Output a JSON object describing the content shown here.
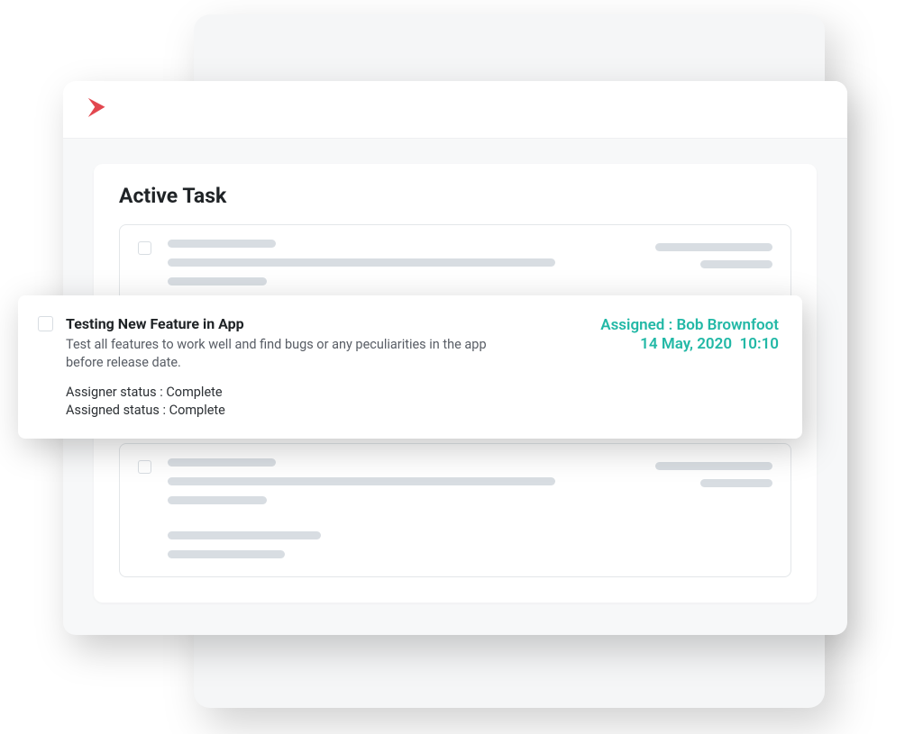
{
  "panel": {
    "title": "Active Task"
  },
  "highlighted_task": {
    "title": "Testing New Feature in App",
    "description": "Test all features to work well and find bugs or any peculiarities in the app before release date.",
    "assigner_status_label": "Assigner status :",
    "assigner_status_value": "Complete",
    "assigned_status_label": "Assigned status :",
    "assigned_status_value": "Complete",
    "assigned_label": "Assigned :",
    "assigned_to": "Bob Brownfoot",
    "date": "14 May, 2020",
    "time": "10:10"
  },
  "colors": {
    "accent_teal": "#22b8a6",
    "logo_red": "#e2474f"
  }
}
